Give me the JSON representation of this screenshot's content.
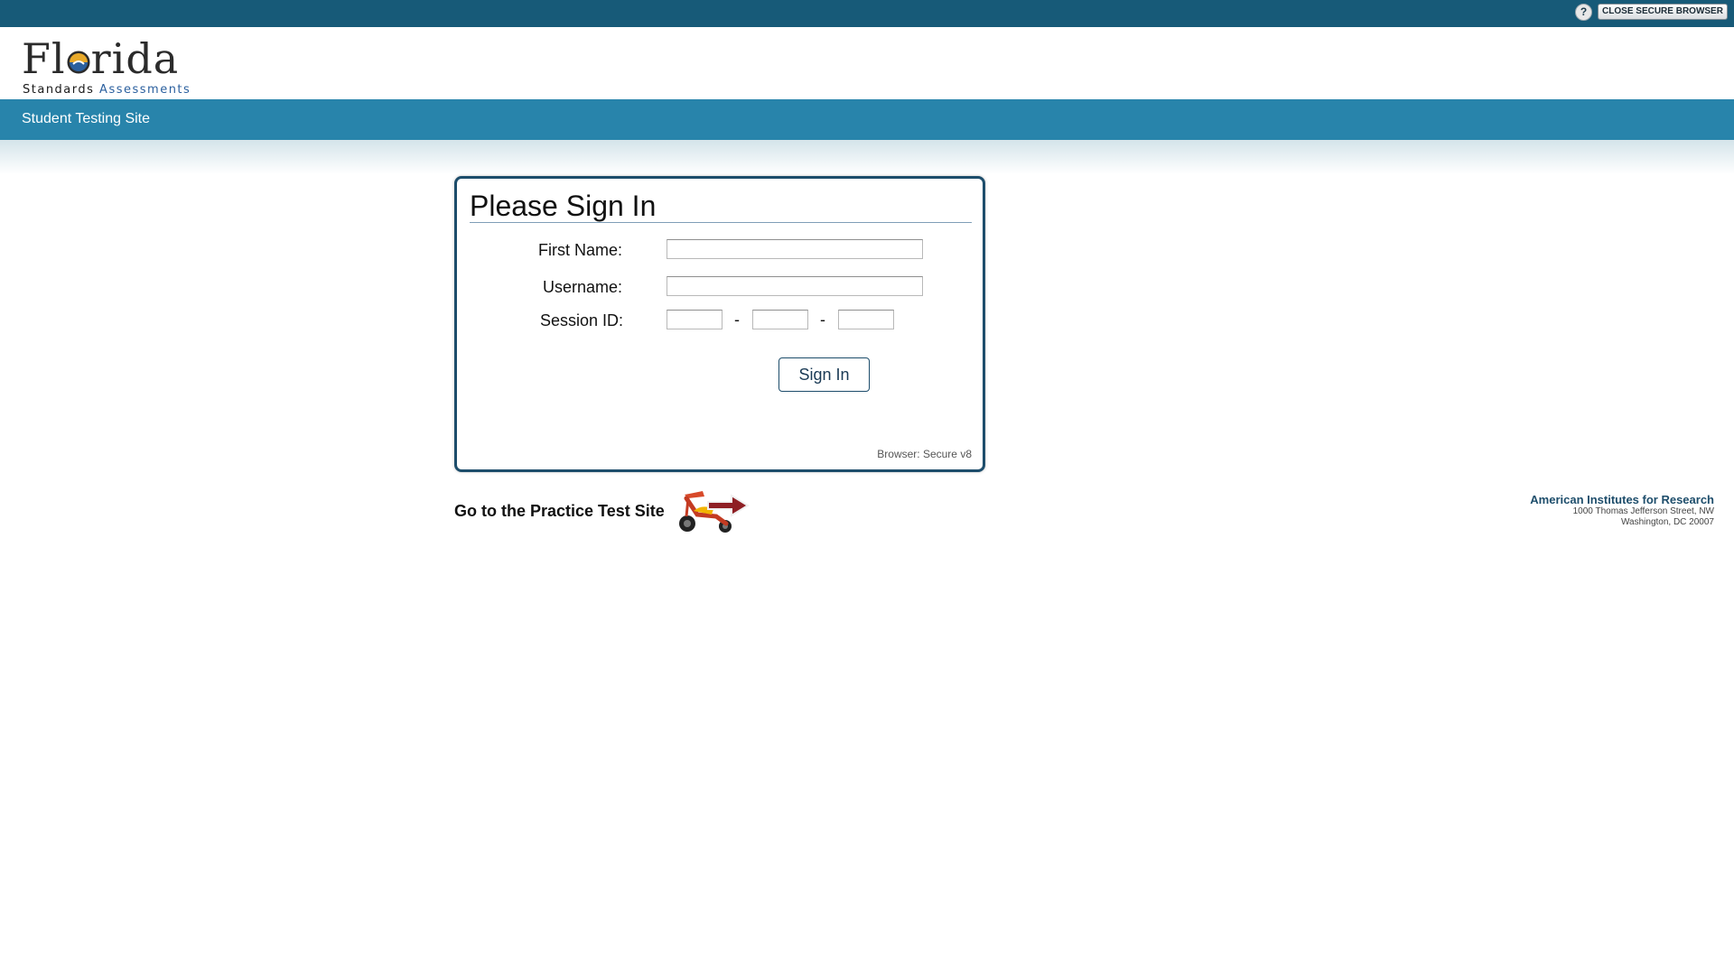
{
  "topbar": {
    "help_label": "?",
    "close_label": "CLOSE SECURE BROWSER"
  },
  "logo": {
    "main_before": "Fl",
    "main_after": "rida",
    "sub_standards": "Standards ",
    "sub_assessments": "Assessments"
  },
  "nav": {
    "title": "Student Testing Site"
  },
  "signin": {
    "title": "Please Sign In",
    "first_name_label": "First Name:",
    "username_label": "Username:",
    "session_label": "Session ID:",
    "dash": "-",
    "button_label": "Sign In",
    "browser_version": "Browser: Secure v8"
  },
  "practice": {
    "link_text": "Go to the Practice Test Site"
  },
  "footer": {
    "org_name": "American Institutes for Research",
    "address_line1": "1000 Thomas Jefferson Street, NW",
    "address_line2": "Washington, DC 20007"
  },
  "colors": {
    "topbar": "#175a78",
    "navbar": "#2884ab",
    "box_border": "#1d4d6b"
  }
}
